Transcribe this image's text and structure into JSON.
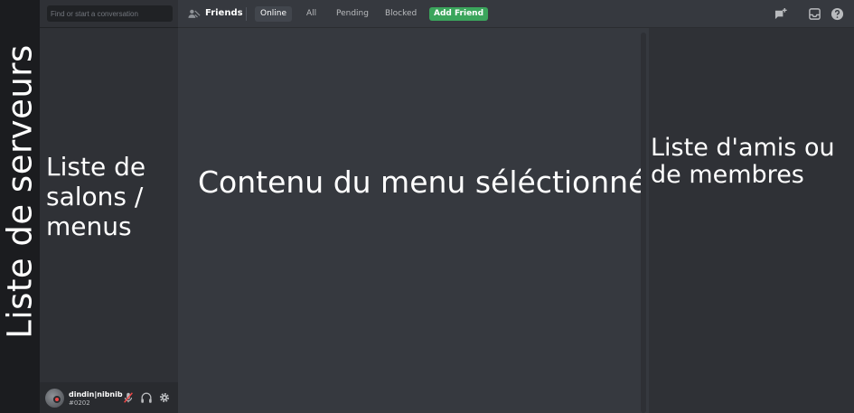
{
  "server_rail": {
    "label": "Liste de serveurs"
  },
  "sidebar": {
    "search_placeholder": "Find or start a conversation",
    "label": "Liste de salons / menus"
  },
  "user_panel": {
    "username": "dindin|nibnib",
    "discriminator": "#0202",
    "status_color": "#f04747"
  },
  "topbar": {
    "title": "Friends",
    "tabs": [
      "Online",
      "All",
      "Pending",
      "Blocked"
    ],
    "active_tab": "Online",
    "add_friend_label": "Add Friend",
    "icons": [
      "friends-icon",
      "new-group-dm-icon",
      "inbox-icon",
      "help-icon"
    ]
  },
  "main": {
    "label": "Contenu du menu séléctionné"
  },
  "members": {
    "label": "Liste d'amis ou de membres"
  },
  "colors": {
    "server_rail": "#1b1c1f",
    "sidebar": "#2f3136",
    "main": "#36393f",
    "accent_green": "#3ba55c"
  }
}
